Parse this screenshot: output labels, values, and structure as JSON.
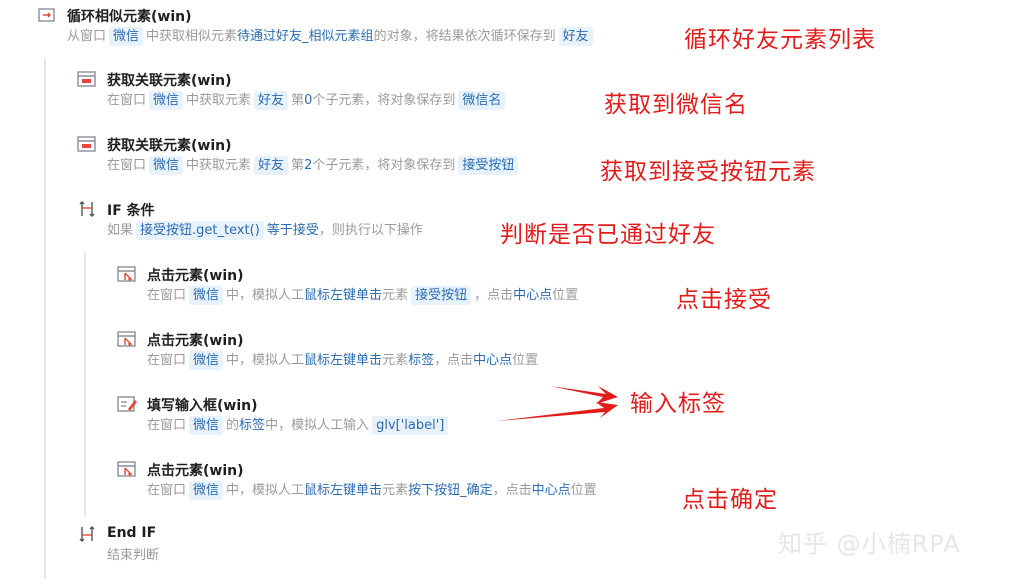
{
  "steps": [
    {
      "title": "循环相似元素(win)",
      "desc": [
        {
          "t": "从窗口"
        },
        {
          "chip": "微信"
        },
        {
          "t": "中获取相似元素"
        },
        {
          "kw": "待通过好友_相似元素组"
        },
        {
          "t": "的对象，将结果依次循环保存到"
        },
        {
          "chip": "好友"
        }
      ]
    },
    {
      "title": "获取关联元素(win)",
      "desc": [
        {
          "t": "在窗口"
        },
        {
          "chip": "微信"
        },
        {
          "t": "中获取元素"
        },
        {
          "chip": "好友"
        },
        {
          "t": "第"
        },
        {
          "kw": "0"
        },
        {
          "t": "个子元素，将对象保存到"
        },
        {
          "chip": "微信名"
        }
      ]
    },
    {
      "title": "获取关联元素(win)",
      "desc": [
        {
          "t": "在窗口"
        },
        {
          "chip": "微信"
        },
        {
          "t": "中获取元素"
        },
        {
          "chip": "好友"
        },
        {
          "t": "第"
        },
        {
          "kw": "2"
        },
        {
          "t": "个子元素，将对象保存到"
        },
        {
          "chip": "接受按钮"
        }
      ]
    },
    {
      "title": "IF 条件",
      "desc": [
        {
          "t": "如果"
        },
        {
          "chip": "接受按钮.get_text()"
        },
        {
          "kw": "等于"
        },
        {
          "kw": "接受"
        },
        {
          "t": "，则执行以下操作"
        }
      ]
    },
    {
      "title": "点击元素(win)",
      "desc": [
        {
          "t": "在窗口"
        },
        {
          "chip": "微信"
        },
        {
          "t": "中，模拟人工"
        },
        {
          "kw": "鼠标左键单击"
        },
        {
          "t": "元素"
        },
        {
          "chip": "接受按钮"
        },
        {
          "t": "，点击"
        },
        {
          "kw": "中心点"
        },
        {
          "t": "位置"
        }
      ]
    },
    {
      "title": "点击元素(win)",
      "desc": [
        {
          "t": "在窗口"
        },
        {
          "chip": "微信"
        },
        {
          "t": "中，模拟人工"
        },
        {
          "kw": "鼠标左键单击"
        },
        {
          "t": "元素"
        },
        {
          "kw": "标签"
        },
        {
          "t": "，点击"
        },
        {
          "kw": "中心点"
        },
        {
          "t": "位置"
        }
      ]
    },
    {
      "title": "填写输入框(win)",
      "desc": [
        {
          "t": "在窗口"
        },
        {
          "chip": "微信"
        },
        {
          "t": "的"
        },
        {
          "kw": "标签"
        },
        {
          "t": "中，模拟人工输入"
        },
        {
          "chip": "glv['label']"
        }
      ]
    },
    {
      "title": "点击元素(win)",
      "desc": [
        {
          "t": "在窗口"
        },
        {
          "chip": "微信"
        },
        {
          "t": "中，模拟人工"
        },
        {
          "kw": "鼠标左键单击"
        },
        {
          "t": "元素"
        },
        {
          "kw": "按下按钮_确定"
        },
        {
          "t": "，点击"
        },
        {
          "kw": "中心点"
        },
        {
          "t": "位置"
        }
      ]
    },
    {
      "title": "End IF",
      "desc": [
        {
          "t": "结束判断"
        }
      ]
    }
  ],
  "icons": [
    "loop-icon",
    "element-icon",
    "element-icon",
    "if-icon",
    "click-icon",
    "click-icon",
    "input-icon",
    "click-icon",
    "endif-icon"
  ],
  "notes": [
    "循环好友元素列表",
    "获取到微信名",
    "获取到接受按钮元素",
    "判断是否已通过好友",
    "点击接受",
    "输入标签",
    "点击确定"
  ],
  "watermark": "知乎 @小楠RPA",
  "colors": {
    "note": "#e21b1b",
    "chip_bg": "#e8f2fc",
    "keyword": "#2b6cb0"
  }
}
